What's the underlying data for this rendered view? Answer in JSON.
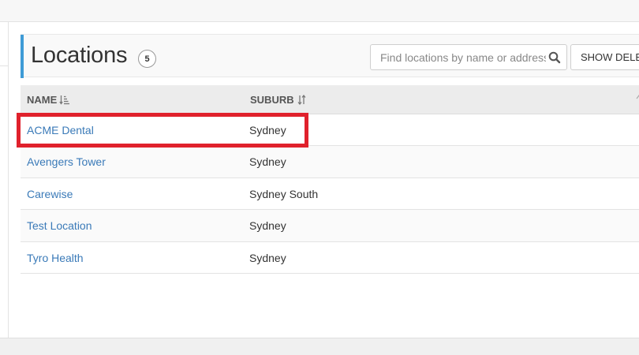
{
  "header": {
    "title": "Locations",
    "count": "5",
    "search_placeholder": "Find locations by name or address",
    "show_button_label": "SHOW DELETED"
  },
  "table": {
    "columns": [
      {
        "label": "NAME",
        "sort_icon": "sort-ascending-icon"
      },
      {
        "label": "SUBURB",
        "sort_icon": "sort-both-icon"
      }
    ],
    "rows": [
      {
        "name": "ACME Dental",
        "suburb": "Sydney"
      },
      {
        "name": "Avengers Tower",
        "suburb": "Sydney"
      },
      {
        "name": "Carewise",
        "suburb": "Sydney South"
      },
      {
        "name": "Test Location",
        "suburb": "Sydney"
      },
      {
        "name": "Tyro Health",
        "suburb": "Sydney"
      }
    ]
  },
  "colors": {
    "accent": "#3e9bd6",
    "link": "#3a7ab8",
    "highlight": "#e0212c"
  }
}
